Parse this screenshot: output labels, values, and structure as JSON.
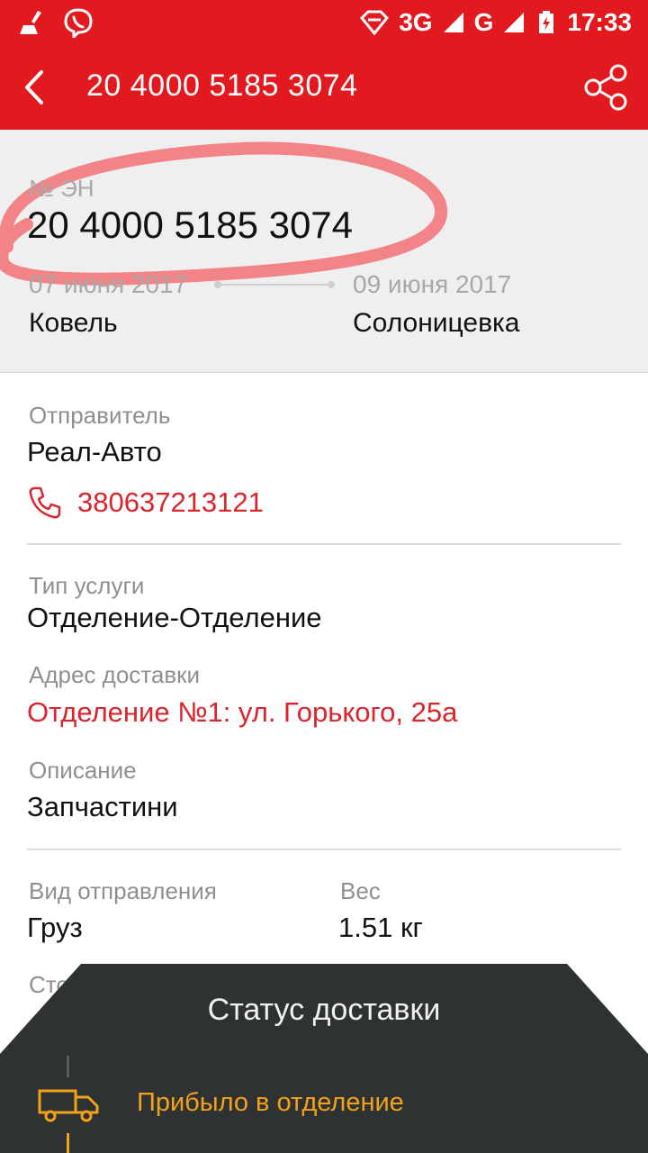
{
  "status_bar": {
    "network_3g": "3G",
    "network_g": "G",
    "time": "17:33"
  },
  "app_bar": {
    "title": "20 4000 5185 3074"
  },
  "header": {
    "en_label": "№ ЭН",
    "en_number": "20 4000 5185 3074",
    "date_from": "07 июня 2017",
    "date_to": "09 июня 2017",
    "city_from": "Ковель",
    "city_to": "Солоницевка"
  },
  "sender": {
    "label": "Отправитель",
    "name": "Реал-Авто",
    "phone": "380637213121"
  },
  "details": {
    "service_type_label": "Тип услуги",
    "service_type": "Отделение-Отделение",
    "address_label": "Адрес доставки",
    "address": "Отделение №1: ул. Горького, 25а",
    "description_label": "Описание",
    "description": "Запчастини"
  },
  "shipment": {
    "kind_label": "Вид отправления",
    "kind": "Груз",
    "weight_label": "Вес",
    "weight": "1.51 кг",
    "cost_label_partial": "Сто"
  },
  "delivery_status": {
    "title": "Статус доставки",
    "current": "Прибыло в отделение"
  },
  "colors": {
    "brand_red": "#e21a1f",
    "link_red": "#d9252b",
    "status_orange": "#f2a21a",
    "sheet_dark": "#2f3233"
  }
}
